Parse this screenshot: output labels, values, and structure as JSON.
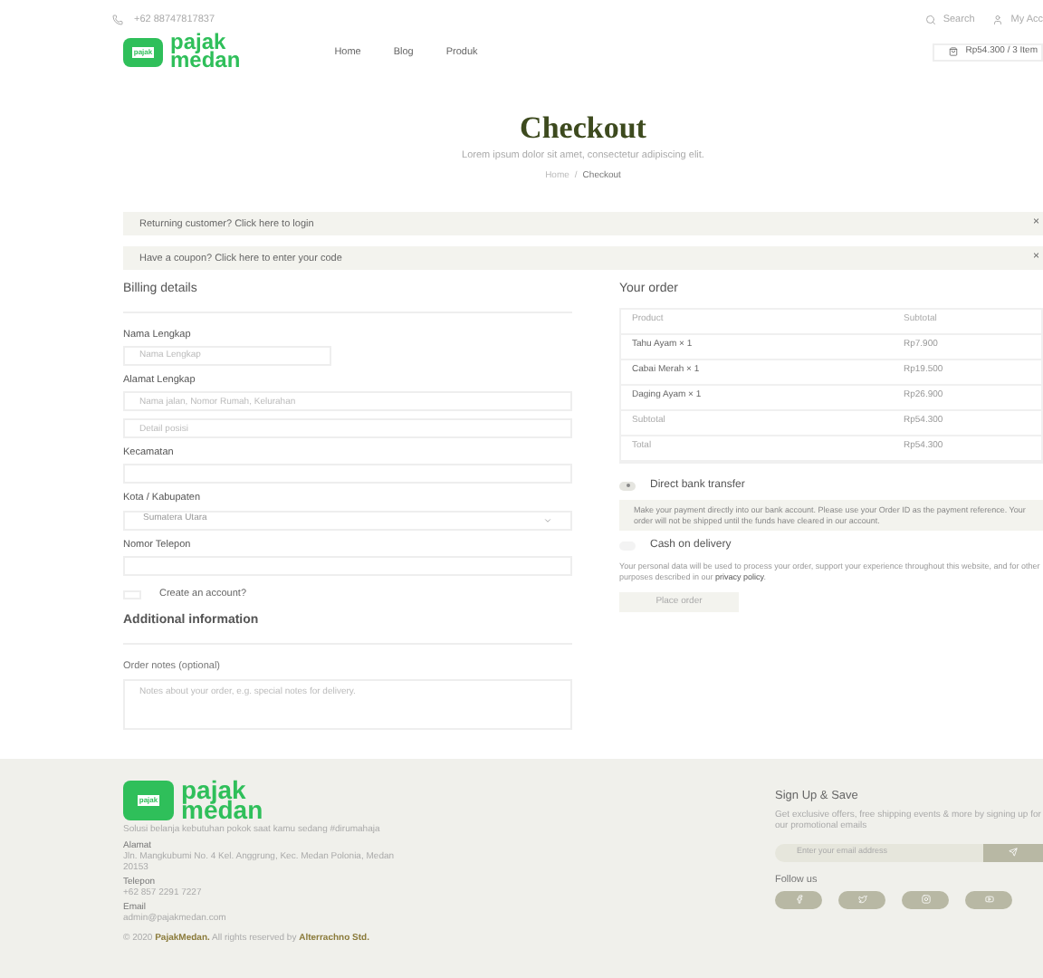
{
  "topbar": {
    "phone": "+62 88747817837",
    "links": [
      {
        "kind": "search",
        "label": "Search"
      },
      {
        "kind": "account",
        "label": "My Acc"
      }
    ]
  },
  "header": {
    "logo": {
      "badge": "pajak",
      "line1": "pajak",
      "line2": "medan"
    },
    "nav": [
      {
        "label": "Home",
        "selected": false
      },
      {
        "label": "Blog",
        "selected": false
      },
      {
        "label": "Produk",
        "selected": false
      }
    ],
    "cart": "Rp54.300 / 3 Item"
  },
  "hero": {
    "title": "Checkout",
    "subtitle": "Lorem ipsum dolor sit amet, consectetur adipiscing elit.",
    "breadcrumb": [
      "Home",
      "Checkout"
    ],
    "separator": "/"
  },
  "notices": [
    {
      "text": "Returning customer? Click here to login",
      "close": "×"
    },
    {
      "text": "Have a coupon? Click here to enter your code",
      "close": "×"
    }
  ],
  "billing": {
    "title": "Billing details",
    "fields": [
      {
        "kind": "short_input",
        "label": "Nama Lengkap",
        "placeholder": "Nama Lengkap"
      },
      {
        "kind": "input",
        "label": "Alamat Lengkap",
        "placeholder": "Nama jalan, Nomor Rumah, Kelurahan"
      },
      {
        "kind": "input",
        "placeholder": "Detail posisi"
      },
      {
        "kind": "input",
        "label": "Kecamatan"
      },
      {
        "kind": "select",
        "label": "Kota / Kabupaten",
        "value": "Sumatera Utara"
      },
      {
        "kind": "input",
        "label": "Nomor Telepon"
      }
    ],
    "create_account": {
      "label": "Create an account?",
      "checked": false
    }
  },
  "additional": {
    "title": "Additional information",
    "label": "Order notes (optional)",
    "placeholder": "Notes about your order, e.g. special notes for delivery."
  },
  "order": {
    "title": "Your order",
    "columns": [
      "Product",
      "Subtotal"
    ],
    "rows": [
      {
        "kind": "item",
        "product": "Tahu Ayam × 1",
        "subtotal": "Rp7.900"
      },
      {
        "kind": "item",
        "product": "Cabai Merah × 1",
        "subtotal": "Rp19.500"
      },
      {
        "kind": "item",
        "product": "Daging Ayam × 1",
        "subtotal": "Rp26.900"
      },
      {
        "kind": "sum",
        "product": "Subtotal",
        "subtotal": "Rp54.300"
      },
      {
        "kind": "sum",
        "product": "Total",
        "subtotal": "Rp54.300"
      }
    ],
    "payments": [
      {
        "label": "Direct bank transfer",
        "selected": true,
        "description": "Make your payment directly into our bank account. Please use your Order ID as the payment reference. Your order will not be shipped until the funds have cleared in our account."
      },
      {
        "label": "Cash on delivery",
        "selected": false
      }
    ],
    "privacy": {
      "text": "Your personal data will be used to process your order, support your experience throughout this website, and for other purposes described in our",
      "link": "privacy policy",
      "end": "."
    },
    "button": "Place order"
  },
  "footer": {
    "logo": {
      "badge": "pajak",
      "line1": "pajak",
      "line2": "medan"
    },
    "tagline": "Solusi belanja kebutuhan pokok saat kamu sedang #dirumahaja",
    "contacts": [
      {
        "label": "Alamat",
        "value": "Jln. Mangkubumi No. 4 Kel. Anggrung, Kec. Medan Polonia, Medan 20153"
      },
      {
        "label": "Telepon",
        "value": "+62 857 2291 7227"
      },
      {
        "label": "Email",
        "value": "admin@pajakmedan.com"
      }
    ],
    "copyright": {
      "prefix": "© 2020",
      "brand": "PajakMedan.",
      "middle": "All rights reserved by",
      "author": "Alterrachno Std."
    },
    "signup": {
      "title": "Sign Up & Save",
      "text": "Get exclusive offers, free shipping events & more by signing up for our promotional emails",
      "placeholder": "Enter your email address"
    },
    "follow": "Follow us",
    "socials": [
      {
        "kind": "facebook"
      },
      {
        "kind": "twitter"
      },
      {
        "kind": "instagram"
      },
      {
        "kind": "youtube"
      }
    ]
  }
}
